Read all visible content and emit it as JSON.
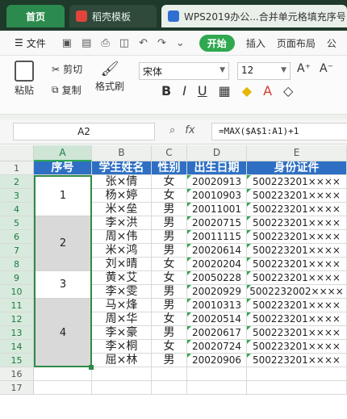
{
  "tabs": [
    {
      "label": "首页"
    },
    {
      "label": "稻壳模板"
    },
    {
      "label": "WPS2019办公...合并单元格填充序号"
    }
  ],
  "menu": {
    "file_label": "文件",
    "start_label": "开始",
    "insert_label": "插入",
    "layout_label": "页面布局",
    "more_label": "公"
  },
  "ribbon": {
    "paste_label": "粘贴",
    "cut_label": "剪切",
    "copy_label": "复制",
    "format_painter_label": "格式刷",
    "font_name": "宋体",
    "font_size": "12"
  },
  "formula_bar": {
    "cell_ref": "A2",
    "fx_label": "fx",
    "formula": "=MAX($A$1:A1)+1"
  },
  "columns": [
    "A",
    "B",
    "C",
    "D",
    "E"
  ],
  "rows": [
    "1",
    "2",
    "3",
    "4",
    "5",
    "6",
    "7",
    "8",
    "9",
    "10",
    "11",
    "12",
    "13",
    "14",
    "15",
    "16",
    "17"
  ],
  "header": {
    "seq": "序号",
    "name": "学生姓名",
    "gender": "性别",
    "birth": "出生日期",
    "id": "身份证件"
  },
  "merged_seq": [
    "1",
    "2",
    "3",
    "4"
  ],
  "records": [
    {
      "name": "张×倩",
      "gender": "女",
      "birth": "20020913",
      "id": "500223201××××"
    },
    {
      "name": "杨×婷",
      "gender": "女",
      "birth": "20010903",
      "id": "500223201××××"
    },
    {
      "name": "米×垒",
      "gender": "男",
      "birth": "20011001",
      "id": "500223201××××"
    },
    {
      "name": "李×洪",
      "gender": "男",
      "birth": "20020715",
      "id": "500223201××××"
    },
    {
      "name": "周×伟",
      "gender": "男",
      "birth": "20011115",
      "id": "500223201××××"
    },
    {
      "name": "米×鸿",
      "gender": "男",
      "birth": "20020614",
      "id": "500223201××××"
    },
    {
      "name": "刘×晴",
      "gender": "女",
      "birth": "20020204",
      "id": "500223201××××"
    },
    {
      "name": "黄×艾",
      "gender": "女",
      "birth": "20050228",
      "id": "500223201××××"
    },
    {
      "name": "李×雯",
      "gender": "男",
      "birth": "20020929",
      "id": "5002232002××××"
    },
    {
      "name": "马×烽",
      "gender": "男",
      "birth": "20010313",
      "id": "500223201××××"
    },
    {
      "name": "周×华",
      "gender": "女",
      "birth": "20020514",
      "id": "500223201××××"
    },
    {
      "name": "李×豪",
      "gender": "男",
      "birth": "20020617",
      "id": "500223201××××"
    },
    {
      "name": "李×桐",
      "gender": "女",
      "birth": "20020724",
      "id": "500223201××××"
    },
    {
      "name": "屈×林",
      "gender": "男",
      "birth": "20020906",
      "id": "500223201××××"
    }
  ],
  "colors": {
    "header_fill": "#2e6fc4",
    "selection": "#2e8b47",
    "merged_grey": "#d9d9d9"
  }
}
